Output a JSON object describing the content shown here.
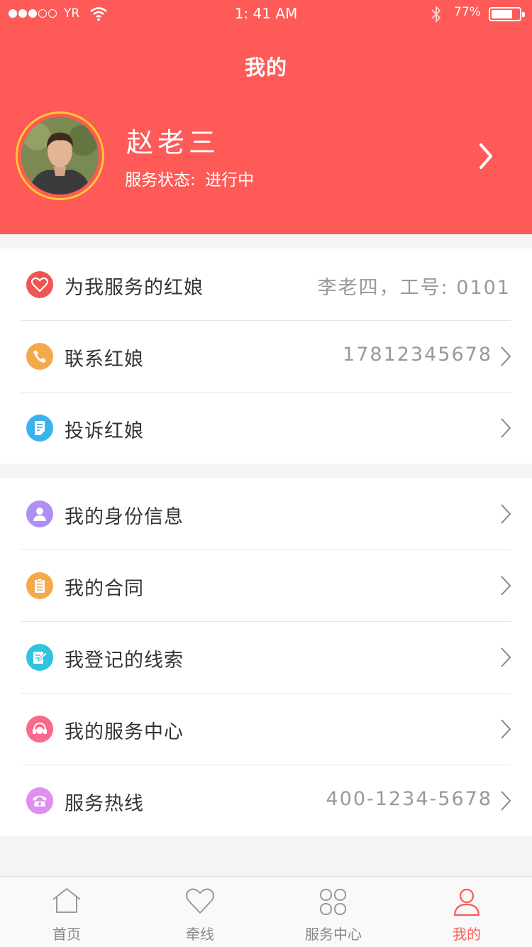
{
  "status_bar": {
    "carrier": "YR",
    "time": "1: 41 AM",
    "battery": "77%",
    "battery_level": 0.77
  },
  "header": {
    "title": "我的",
    "user_name": "赵老三",
    "status_label": "服务状态:",
    "status_value": "进行中"
  },
  "group1": [
    {
      "label": "为我服务的红娘",
      "value": "李老四，工号: 0101",
      "icon": "heart-icon",
      "color": "#ef5552"
    },
    {
      "label": "联系红娘",
      "value": "17812345678",
      "icon": "phone-icon",
      "color": "#f6a94b"
    },
    {
      "label": "投诉红娘",
      "value": "",
      "icon": "document-icon",
      "color": "#39b3f0"
    }
  ],
  "group2": [
    {
      "label": "我的身份信息",
      "value": "",
      "icon": "person-icon",
      "color": "#b08ef3"
    },
    {
      "label": "我的合同",
      "value": "",
      "icon": "clipboard-icon",
      "color": "#f6a94b"
    },
    {
      "label": "我登记的线索",
      "value": "",
      "icon": "edit-icon",
      "color": "#2fc4de"
    },
    {
      "label": "我的服务中心",
      "value": "",
      "icon": "headset-icon",
      "color": "#f76b8a"
    },
    {
      "label": "服务热线",
      "value": "400-1234-5678",
      "icon": "telephone-icon",
      "color": "#e08ef0"
    }
  ],
  "tabs": [
    {
      "label": "首页",
      "icon": "home-icon"
    },
    {
      "label": "牵线",
      "icon": "heart-outline-icon"
    },
    {
      "label": "服务中心",
      "icon": "grid-icon"
    },
    {
      "label": "我的",
      "icon": "user-icon"
    }
  ],
  "colors": {
    "brand": "#fe5a57",
    "avatar_ring": "#ffc830"
  }
}
